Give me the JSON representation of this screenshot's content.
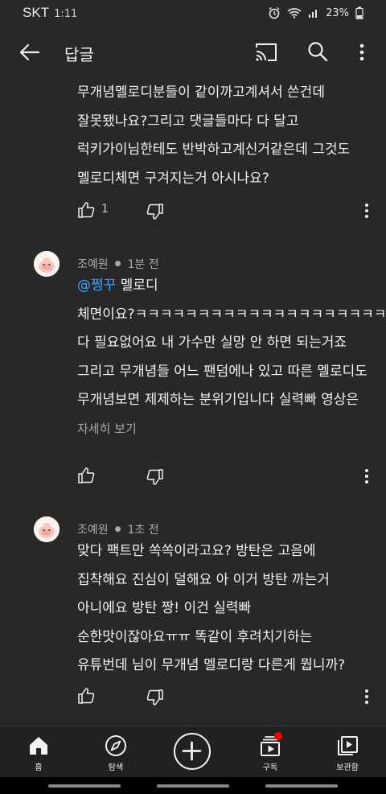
{
  "status_bar": {
    "carrier": "SKT",
    "time": "1:11",
    "battery": "23%",
    "icons": [
      "alarm-icon",
      "wifi-icon",
      "signal-icon",
      "battery-icon"
    ]
  },
  "app_bar": {
    "title": "답글",
    "icons": [
      "back-arrow-icon",
      "cast-icon",
      "search-icon",
      "more-vert-icon"
    ]
  },
  "comments": [
    {
      "lines": [
        "무개념멜로디분들이 같이까고계셔서 쓴건데",
        "잘못됐나요?그리고 댓글들마다 다 달고",
        "럭키가이님한테도 반박하고계신거같은데 그것도",
        "멜로디체면 구겨지는거 아시나요?"
      ],
      "likes": "1"
    },
    {
      "author": "조예원",
      "time": "1분 전",
      "mention": "@쩡꾸",
      "lines": [
        "멜로디",
        "체면이요?ㅋㅋㅋㅋㅋㅋㅋㅋㅋㅋㅋㅋㅋㅋㅋㅋㅋㅋㅋㅋㅋ",
        "다 필요없어요 내 가수만 실망 안 하면 되는거죠",
        "그리고 무개념들 어느 팬덤에나 있고 따른 멜로디도",
        "무개념보면 제제하는 분위기입니다 실력빠 영상은"
      ],
      "show_more": "자세히 보기"
    },
    {
      "author": "조예원",
      "time": "1초 전",
      "lines": [
        "맞다 팩트만 쏙쏙이라고요? 방탄은 고음에",
        "집착해요 진심이 덜해요 아 이거 방탄 까는거",
        "아니에요 방탄 짱! 이건 실력빠",
        "순한맛이잖아요ㅠㅠ 똑같이 후려치기하는",
        "유튜번데 님이 무개념 멜로디랑 다른게 뭡니까?"
      ]
    }
  ],
  "bottom_nav": {
    "items": [
      {
        "label": "홈",
        "icon": "home-icon"
      },
      {
        "label": "탐색",
        "icon": "explore-icon"
      },
      {
        "label": "",
        "icon": "create-icon"
      },
      {
        "label": "구독",
        "icon": "subscriptions-icon"
      },
      {
        "label": "보관함",
        "icon": "library-icon"
      }
    ]
  },
  "colors": {
    "background": "#282828",
    "mention": "#3ea6ff",
    "notification_dot": "#ff0000"
  }
}
